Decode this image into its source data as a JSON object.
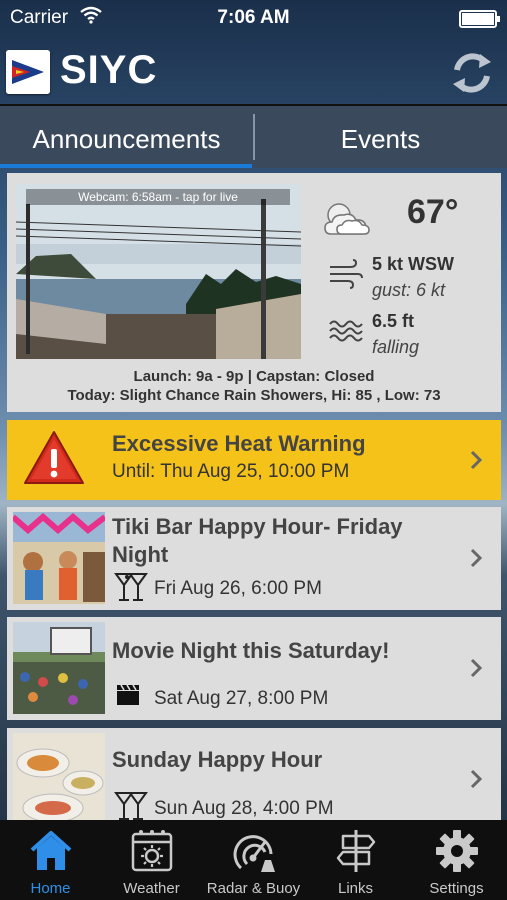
{
  "status_bar": {
    "carrier": "Carrier",
    "time": "7:06 AM"
  },
  "header": {
    "title": "SIYC"
  },
  "tabs": [
    {
      "label": "Announcements",
      "selected": true
    },
    {
      "label": "Events",
      "selected": false
    }
  ],
  "weather": {
    "webcam_label": "Webcam:  6:58am - tap for live",
    "temperature": "67°",
    "wind": "5 kt WSW",
    "gust": "gust: 6 kt",
    "tide_height": "6.5 ft",
    "tide_trend": "falling",
    "launch_info": "Launch: 9a - 9p  |  Capstan: Closed",
    "forecast": "Today: Slight Chance Rain Showers, Hi: 85 , Low: 73"
  },
  "alert": {
    "title": "Excessive Heat Warning",
    "until": "Until: Thu Aug 25, 10:00 PM",
    "color": "#f5c21a"
  },
  "events": [
    {
      "title": "Tiki Bar Happy Hour- Friday Night",
      "date": "Fri Aug 26, 6:00 PM",
      "icon": "martini-icon"
    },
    {
      "title": "Movie Night this Saturday!",
      "date": "Sat Aug 27, 8:00 PM",
      "icon": "clapperboard-icon"
    },
    {
      "title": "Sunday Happy Hour",
      "date": "Sun Aug 28, 4:00 PM",
      "icon": "martini-icon"
    }
  ],
  "tab_bar": [
    {
      "label": "Home",
      "icon": "home-icon",
      "active": true
    },
    {
      "label": "Weather",
      "icon": "weather-icon",
      "active": false
    },
    {
      "label": "Radar & Buoy",
      "icon": "radar-icon",
      "active": false
    },
    {
      "label": "Links",
      "icon": "signpost-icon",
      "active": false
    },
    {
      "label": "Settings",
      "icon": "gear-icon",
      "active": false
    }
  ],
  "colors": {
    "accent": "#2f8fe8",
    "card": "#dddddd",
    "alert": "#f5c21a",
    "tabbar": "#0f0f0f"
  }
}
